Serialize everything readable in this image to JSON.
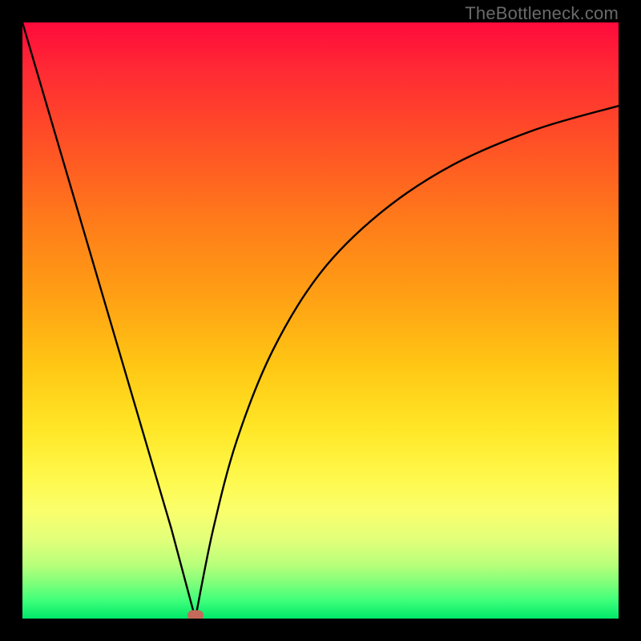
{
  "watermark": "TheBottleneck.com",
  "colors": {
    "frame_border": "#000000",
    "curve_stroke": "#000000",
    "marker_fill": "#c56a5a"
  },
  "chart_data": {
    "type": "line",
    "title": "",
    "xlabel": "",
    "ylabel": "",
    "xlim": [
      0,
      100
    ],
    "ylim": [
      0,
      100
    ],
    "grid": false,
    "curve_left": {
      "description": "Steep descending segment from top-left to minimum",
      "x": [
        0,
        5,
        10,
        15,
        20,
        25,
        29
      ],
      "y": [
        100,
        83,
        66,
        49,
        32,
        15,
        0
      ]
    },
    "curve_right": {
      "description": "Rising segment from minimum toward top-right with decreasing slope",
      "x": [
        29,
        32,
        36,
        42,
        50,
        60,
        72,
        86,
        100
      ],
      "y": [
        0,
        15,
        30,
        45,
        58,
        68,
        76,
        82,
        86
      ]
    },
    "minimum_point": {
      "x": 29,
      "y": 0
    },
    "marker": {
      "x": 29,
      "y": 0
    }
  }
}
